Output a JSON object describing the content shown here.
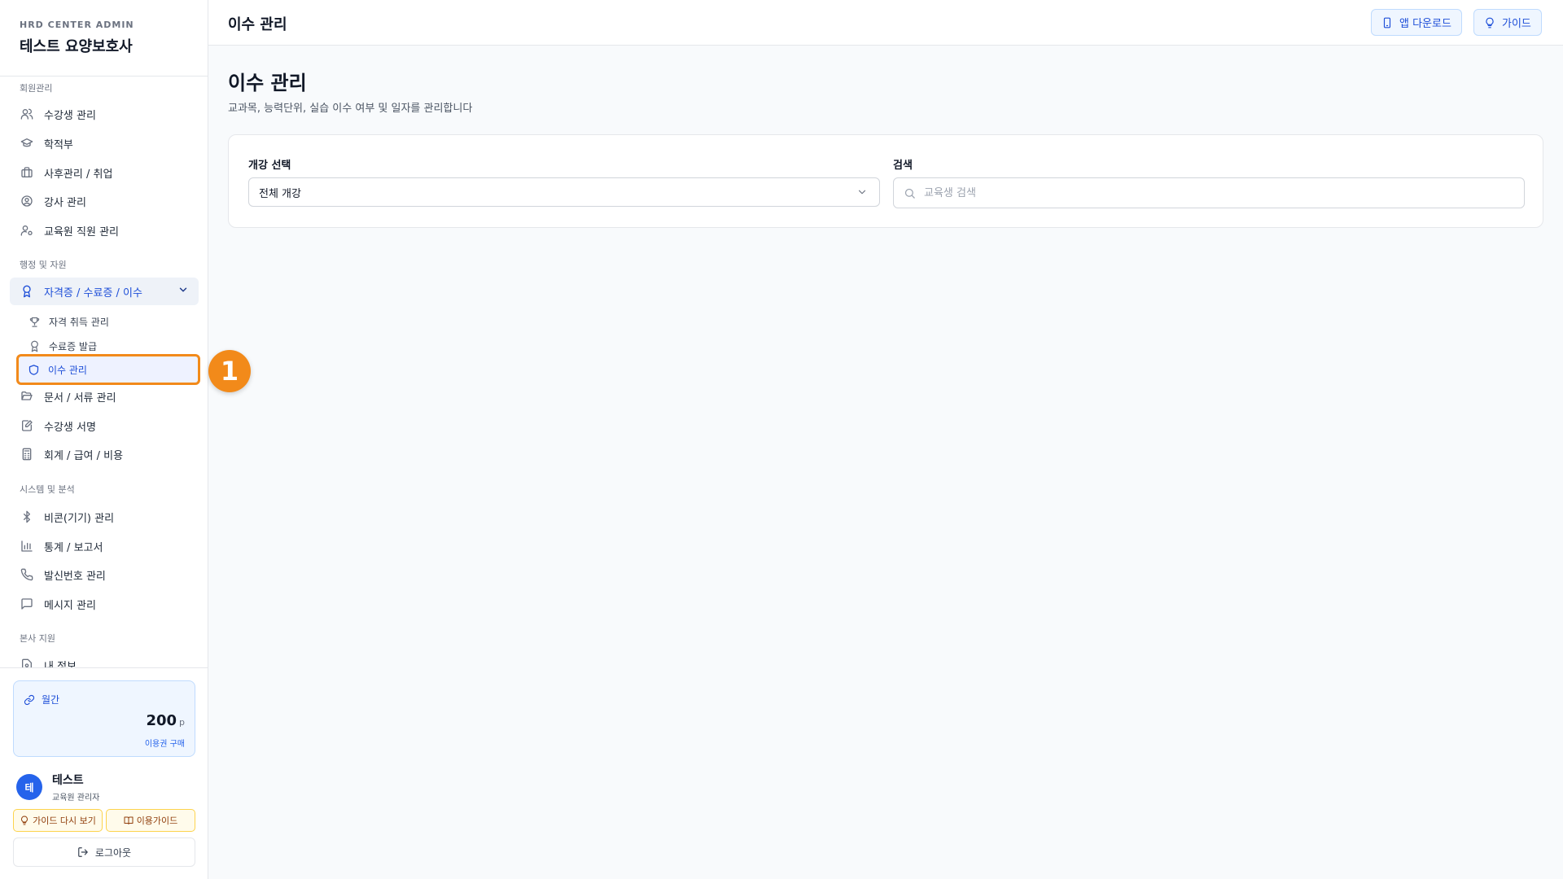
{
  "brand": {
    "subtitle": "HRD CENTER ADMIN",
    "title": "테스트 요양보호사"
  },
  "nav": {
    "sections": {
      "members": "회원관리",
      "admin": "행정 및 자원",
      "system": "시스템 및 분석",
      "hq": "본사 지원"
    },
    "members": [
      {
        "label": "수강생 관리",
        "icon": "users-icon"
      },
      {
        "label": "학적부",
        "icon": "graduation-cap-icon"
      },
      {
        "label": "사후관리 / 취업",
        "icon": "briefcase-icon"
      },
      {
        "label": "강사 관리",
        "icon": "user-circle-icon"
      },
      {
        "label": "교육원 직원 관리",
        "icon": "user-cog-icon"
      }
    ],
    "cert_group": {
      "label": "자격증 / 수료증 / 이수",
      "icon": "award-icon"
    },
    "cert_sub": [
      {
        "label": "자격 취득 관리",
        "icon": "trophy-icon"
      },
      {
        "label": "수료증 발급",
        "icon": "award-icon"
      },
      {
        "label": "이수 관리",
        "icon": "shield-icon"
      }
    ],
    "admin_more": [
      {
        "label": "문서 / 서류 관리",
        "icon": "folder-open-icon"
      },
      {
        "label": "수강생 서명",
        "icon": "file-signature-icon"
      },
      {
        "label": "회계 / 급여 / 비용",
        "icon": "calculator-icon"
      }
    ],
    "system": [
      {
        "label": "비콘(기기) 관리",
        "icon": "bluetooth-icon"
      },
      {
        "label": "통계 / 보고서",
        "icon": "bar-chart-icon"
      },
      {
        "label": "발신번호 관리",
        "icon": "phone-icon"
      },
      {
        "label": "메시지 관리",
        "icon": "message-icon"
      }
    ],
    "hq": [
      {
        "label": "내 정보",
        "icon": "file-user-icon"
      }
    ]
  },
  "marker": "1",
  "plan": {
    "label": "월간",
    "points": "200",
    "unit": "p",
    "link": "이용권 구매"
  },
  "user": {
    "avatar": "테",
    "name": "테스트",
    "role": "교육원 관리자"
  },
  "buttons": {
    "guide_again": "가이드 다시 보기",
    "usage_guide": "이용가이드",
    "logout": "로그아웃"
  },
  "header": {
    "title": "이수 관리",
    "app_download": "앱 다운로드",
    "guide": "가이드"
  },
  "page": {
    "title": "이수 관리",
    "description": "교과목, 능력단위, 실습 이수 여부 및 일자를 관리합니다"
  },
  "filters": {
    "course_label": "개강 선택",
    "course_value": "전체 개강",
    "search_label": "검색",
    "search_placeholder": "교육생 검색"
  },
  "colors": {
    "accent": "#1d4ed8",
    "highlight": "#f28a1a",
    "avatar": "#2563eb"
  }
}
